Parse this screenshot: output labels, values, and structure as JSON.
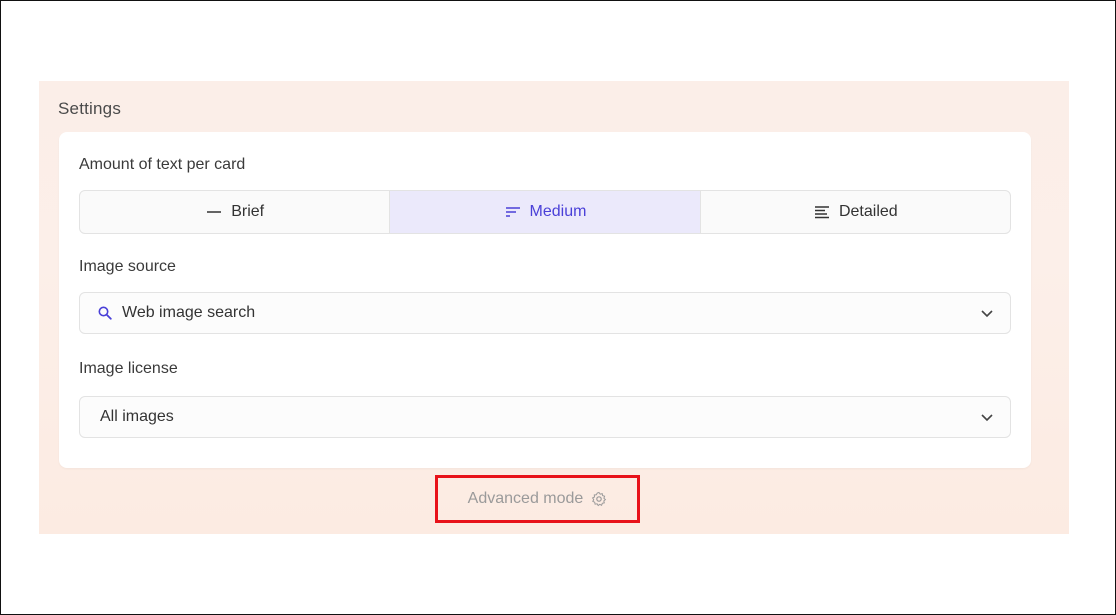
{
  "settings": {
    "title": "Settings",
    "text_amount": {
      "label": "Amount of text per card",
      "options": [
        {
          "label": "Brief",
          "icon": "dash-icon",
          "selected": false
        },
        {
          "label": "Medium",
          "icon": "medium-lines-icon",
          "selected": true
        },
        {
          "label": "Detailed",
          "icon": "detailed-lines-icon",
          "selected": false
        }
      ]
    },
    "image_source": {
      "label": "Image source",
      "value": "Web image search",
      "icon": "search-icon"
    },
    "image_license": {
      "label": "Image license",
      "value": "All images"
    },
    "advanced_mode": {
      "label": "Advanced mode",
      "icon": "gear-icon"
    }
  },
  "colors": {
    "accent": "#4a40d8",
    "accent_bg": "#ebe9fb",
    "highlight_box": "#e8121a",
    "panel_bg": "#fbeee8"
  }
}
